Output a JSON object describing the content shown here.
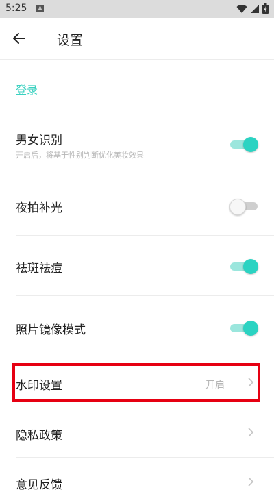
{
  "status_bar": {
    "time": "5:25",
    "notification_icon": "A",
    "icons": [
      "wifi-icon",
      "signal-icon",
      "battery-charging-icon"
    ]
  },
  "app_bar": {
    "back_icon": "arrow-left-icon",
    "title": "设置"
  },
  "section": {
    "header": "登录"
  },
  "settings": [
    {
      "id": "gender",
      "title": "男女识别",
      "subtitle": "开启后，将基于性别判断优化美妆效果",
      "control": "switch",
      "on": true
    },
    {
      "id": "night-light",
      "title": "夜拍补光",
      "control": "switch",
      "on": false
    },
    {
      "id": "blemish",
      "title": "祛斑祛痘",
      "control": "switch",
      "on": true
    },
    {
      "id": "mirror",
      "title": "照片镜像模式",
      "control": "switch",
      "on": true
    },
    {
      "id": "watermark",
      "title": "水印设置",
      "value": "开启",
      "control": "chevron"
    },
    {
      "id": "privacy",
      "title": "隐私政策",
      "control": "chevron"
    },
    {
      "id": "feedback",
      "title": "意见反馈",
      "control": "chevron"
    }
  ],
  "colors": {
    "accent": "#2bd3c2",
    "accent_track": "#9be6dd",
    "highlight": "#e60012"
  }
}
